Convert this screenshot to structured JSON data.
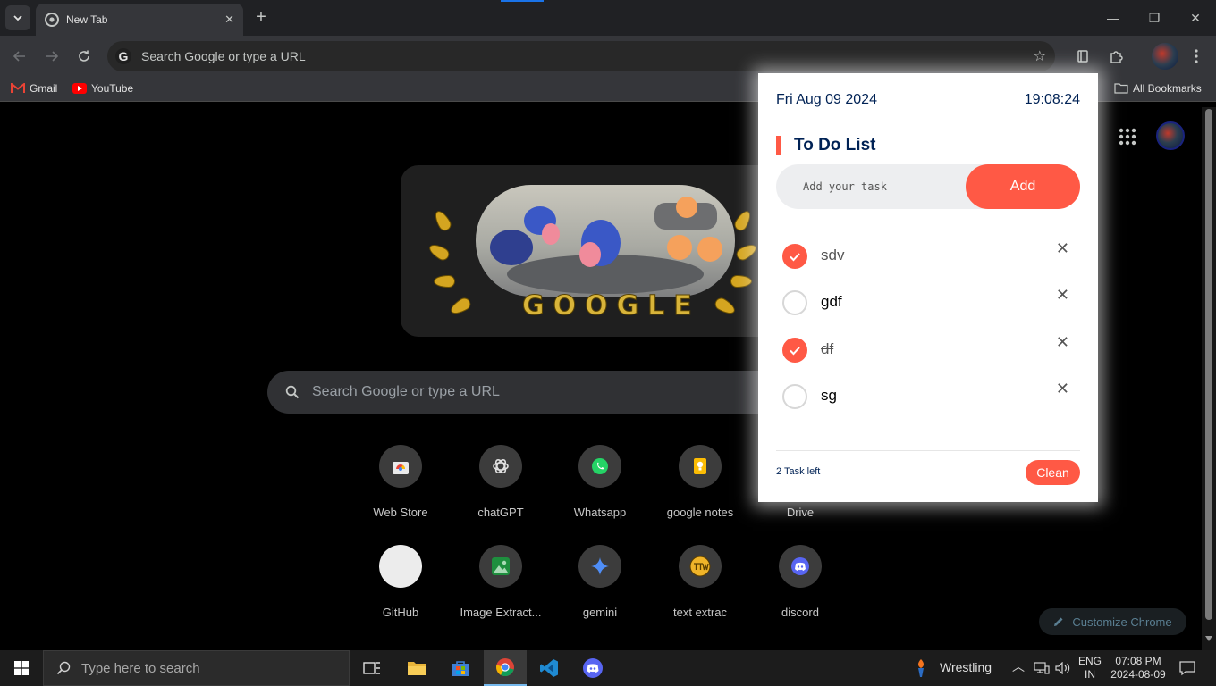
{
  "browser": {
    "tab": {
      "title": "New Tab"
    },
    "omnibox": {
      "placeholder": "Search Google or type a URL"
    },
    "bookmarks": [
      {
        "label": "Gmail",
        "icon": "gmail-icon"
      },
      {
        "label": "YouTube",
        "icon": "youtube-icon"
      }
    ],
    "all_bookmarks_label": "All Bookmarks"
  },
  "ntp": {
    "doodle_text": "GOOGLE",
    "search_placeholder": "Search Google or type a URL",
    "shortcuts_row1": [
      {
        "label": "Web Store",
        "icon": "web-store-icon"
      },
      {
        "label": "chatGPT",
        "icon": "chatgpt-icon"
      },
      {
        "label": "Whatsapp",
        "icon": "whatsapp-icon"
      },
      {
        "label": "google notes",
        "icon": "google-keep-icon"
      },
      {
        "label": "Drive",
        "icon": "drive-icon"
      }
    ],
    "shortcuts_row2": [
      {
        "label": "GitHub",
        "icon": "github-icon"
      },
      {
        "label": "Image Extract...",
        "icon": "image-icon"
      },
      {
        "label": "gemini",
        "icon": "gemini-icon"
      },
      {
        "label": "text extrac",
        "icon": "text-extract-icon"
      },
      {
        "label": "discord",
        "icon": "discord-icon"
      }
    ],
    "customize_label": "Customize Chrome"
  },
  "todo": {
    "date": "Fri Aug 09 2024",
    "time": "19:08:24",
    "heading": "To Do List",
    "input_placeholder": "Add your task",
    "add_label": "Add",
    "tasks": [
      {
        "text": "sdv",
        "done": true
      },
      {
        "text": "gdf",
        "done": false
      },
      {
        "text": "df",
        "done": true
      },
      {
        "text": "sg",
        "done": false
      }
    ],
    "remaining_label": "2 Task left",
    "clean_label": "Clean"
  },
  "taskbar": {
    "search_placeholder": "Type here to search",
    "weather_label": "Wrestling",
    "lang_line1": "ENG",
    "lang_line2": "IN",
    "clock_time": "07:08 PM",
    "clock_date": "2024-08-09"
  },
  "colors": {
    "accent": "#ff5945",
    "popup_text": "#002255",
    "ntp_background": "#000000"
  }
}
